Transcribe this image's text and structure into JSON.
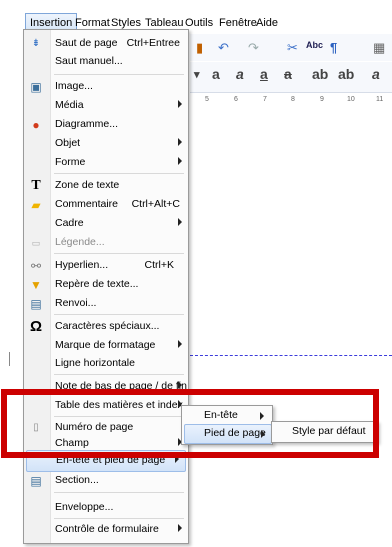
{
  "menubar": {
    "items": [
      "Insertion",
      "Format",
      "Styles",
      "Tableau",
      "Outils",
      "Fenêtre",
      "Aide"
    ]
  },
  "toolbar": {
    "icons": [
      "brush-icon",
      "undo-icon",
      "redo-icon",
      "find-replace-icon",
      "spellcheck-icon",
      "formatting-marks-icon",
      "table-icon"
    ],
    "spell_label": "Abc"
  },
  "formatbar": {
    "bold_label": "a",
    "italic_label": "a",
    "underline_label": "a",
    "strike_label": "a",
    "superscript_label": "ab",
    "subscript_label": "ab",
    "clear_label": "a"
  },
  "ruler": {
    "ticks": [
      "5",
      "6",
      "7",
      "8",
      "9",
      "10",
      "11"
    ]
  },
  "menu": {
    "items": [
      {
        "label": "Saut de page",
        "shortcut": "Ctrl+Entree",
        "icon": "page-break-icon"
      },
      {
        "label": "Saut manuel..."
      },
      {
        "label": "Image...",
        "icon": "image-icon"
      },
      {
        "label": "Média",
        "submenu": true
      },
      {
        "label": "Diagramme...",
        "icon": "chart-icon"
      },
      {
        "label": "Objet",
        "submenu": true
      },
      {
        "label": "Forme",
        "submenu": true
      },
      {
        "label": "Zone de texte",
        "icon": "text-box-icon"
      },
      {
        "label": "Commentaire",
        "shortcut": "Ctrl+Alt+C",
        "icon": "comment-icon"
      },
      {
        "label": "Cadre",
        "submenu": true
      },
      {
        "label": "Légende...",
        "icon": "caption-icon",
        "disabled": true
      },
      {
        "label": "Hyperlien...",
        "shortcut": "Ctrl+K",
        "icon": "hyperlink-icon"
      },
      {
        "label": "Repère de texte...",
        "icon": "bookmark-icon"
      },
      {
        "label": "Renvoi...",
        "icon": "cross-reference-icon"
      },
      {
        "label": "Caractères spéciaux...",
        "icon": "omega-icon"
      },
      {
        "label": "Marque de formatage",
        "submenu": true
      },
      {
        "label": "Ligne horizontale"
      },
      {
        "label": "Note de bas de page / de fin",
        "submenu": true
      },
      {
        "label": "Table des matières et index",
        "submenu": true
      },
      {
        "label": "Numéro de page",
        "icon": "page-number-icon"
      },
      {
        "label": "Champ",
        "submenu": true
      },
      {
        "label": "En-tête et pied de page",
        "submenu": true
      },
      {
        "label": "Section...",
        "icon": "section-icon"
      },
      {
        "label": "Enveloppe..."
      },
      {
        "label": "Contrôle de formulaire",
        "submenu": true
      }
    ]
  },
  "submenu_header_footer": {
    "items": [
      {
        "label": "En-tête",
        "submenu": true
      },
      {
        "label": "Pied de page",
        "submenu": true
      }
    ]
  },
  "submenu_footer": {
    "items": [
      {
        "label": "Style par défaut"
      }
    ]
  },
  "colors": {
    "highlight": "#d2e3f8",
    "red_outline": "#cc0000",
    "separator_line": "#3d3ddb"
  }
}
